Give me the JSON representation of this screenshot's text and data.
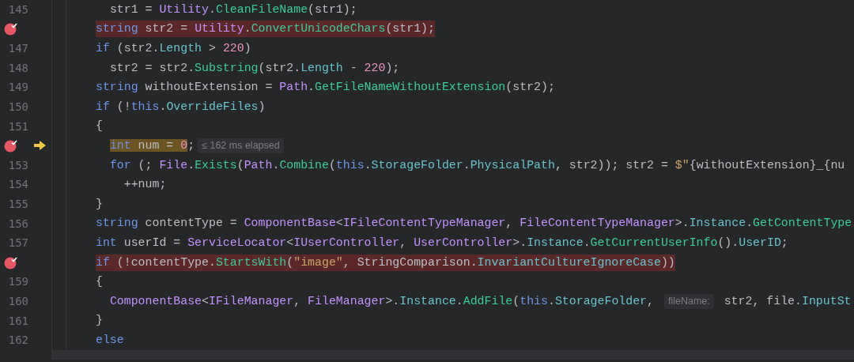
{
  "editor": {
    "lines": [
      {
        "number": "145",
        "breakpoint": false,
        "current": false,
        "highlighted": false,
        "nested": true,
        "tokens": [
          {
            "kind": "plain",
            "text": "str1 = "
          },
          {
            "kind": "type",
            "text": "Utility"
          },
          {
            "kind": "plain",
            "text": "."
          },
          {
            "kind": "method",
            "text": "CleanFileName"
          },
          {
            "kind": "plain",
            "text": "(str1);"
          }
        ]
      },
      {
        "breakpoint": true,
        "current": false,
        "highlighted": true,
        "nested": false,
        "tokens": [
          {
            "kind": "keyword",
            "text": "string"
          },
          {
            "kind": "plain",
            "text": " str2 = "
          },
          {
            "kind": "type",
            "text": "Utility"
          },
          {
            "kind": "plain",
            "text": "."
          },
          {
            "kind": "method",
            "text": "ConvertUnicodeChars"
          },
          {
            "kind": "plain",
            "text": "(str1);"
          }
        ]
      },
      {
        "number": "147",
        "breakpoint": false,
        "current": false,
        "highlighted": false,
        "nested": false,
        "tokens": [
          {
            "kind": "keyword",
            "text": "if"
          },
          {
            "kind": "plain",
            "text": " (str2."
          },
          {
            "kind": "property",
            "text": "Length"
          },
          {
            "kind": "plain",
            "text": " > "
          },
          {
            "kind": "number",
            "text": "220"
          },
          {
            "kind": "plain",
            "text": ")"
          }
        ]
      },
      {
        "number": "148",
        "breakpoint": false,
        "current": false,
        "highlighted": false,
        "nested": true,
        "tokens": [
          {
            "kind": "plain",
            "text": "str2 = str2."
          },
          {
            "kind": "method",
            "text": "Substring"
          },
          {
            "kind": "plain",
            "text": "(str2."
          },
          {
            "kind": "property",
            "text": "Length"
          },
          {
            "kind": "plain",
            "text": " - "
          },
          {
            "kind": "number",
            "text": "220"
          },
          {
            "kind": "plain",
            "text": ");"
          }
        ]
      },
      {
        "number": "149",
        "breakpoint": false,
        "current": false,
        "highlighted": false,
        "nested": false,
        "tokens": [
          {
            "kind": "keyword",
            "text": "string"
          },
          {
            "kind": "plain",
            "text": " withoutExtension = "
          },
          {
            "kind": "type",
            "text": "Path"
          },
          {
            "kind": "plain",
            "text": "."
          },
          {
            "kind": "method",
            "text": "GetFileNameWithoutExtension"
          },
          {
            "kind": "plain",
            "text": "(str2);"
          }
        ]
      },
      {
        "number": "150",
        "breakpoint": false,
        "current": false,
        "highlighted": false,
        "nested": false,
        "tokens": [
          {
            "kind": "keyword",
            "text": "if"
          },
          {
            "kind": "plain",
            "text": " (!"
          },
          {
            "kind": "keyword",
            "text": "this"
          },
          {
            "kind": "plain",
            "text": "."
          },
          {
            "kind": "property",
            "text": "OverrideFiles"
          },
          {
            "kind": "plain",
            "text": ")"
          }
        ]
      },
      {
        "number": "151",
        "breakpoint": false,
        "current": false,
        "highlighted": false,
        "nested": false,
        "tokens": [
          {
            "kind": "plain",
            "text": "{"
          }
        ]
      },
      {
        "breakpoint": true,
        "current": true,
        "highlighted": false,
        "nested": true,
        "tokens": [
          {
            "kind": "keyword",
            "text": "int",
            "executing": true
          },
          {
            "kind": "plain",
            "text": " num = ",
            "executing": true
          },
          {
            "kind": "number",
            "text": "0",
            "executing": true
          },
          {
            "kind": "plain",
            "text": ";",
            "executing": false
          },
          {
            "kind": "hint",
            "text": "≤ 162 ms elapsed"
          }
        ]
      },
      {
        "number": "153",
        "breakpoint": false,
        "current": false,
        "highlighted": false,
        "nested": true,
        "tokens": [
          {
            "kind": "keyword",
            "text": "for"
          },
          {
            "kind": "plain",
            "text": " (; "
          },
          {
            "kind": "type",
            "text": "File"
          },
          {
            "kind": "plain",
            "text": "."
          },
          {
            "kind": "method",
            "text": "Exists"
          },
          {
            "kind": "plain",
            "text": "("
          },
          {
            "kind": "type",
            "text": "Path"
          },
          {
            "kind": "plain",
            "text": "."
          },
          {
            "kind": "method",
            "text": "Combine"
          },
          {
            "kind": "plain",
            "text": "("
          },
          {
            "kind": "keyword",
            "text": "this"
          },
          {
            "kind": "plain",
            "text": "."
          },
          {
            "kind": "property",
            "text": "StorageFolder"
          },
          {
            "kind": "plain",
            "text": "."
          },
          {
            "kind": "property",
            "text": "PhysicalPath"
          },
          {
            "kind": "plain",
            "text": ", str2)); str2 = "
          },
          {
            "kind": "string",
            "text": "$\""
          },
          {
            "kind": "plain",
            "text": "{withoutExtension}_{nu"
          }
        ]
      },
      {
        "number": "154",
        "breakpoint": false,
        "current": false,
        "highlighted": false,
        "nested": true,
        "tokens": [
          {
            "kind": "plain",
            "text": "  ++num;"
          }
        ]
      },
      {
        "number": "155",
        "breakpoint": false,
        "current": false,
        "highlighted": false,
        "nested": false,
        "tokens": [
          {
            "kind": "plain",
            "text": "}"
          }
        ]
      },
      {
        "number": "156",
        "breakpoint": false,
        "current": false,
        "highlighted": false,
        "nested": false,
        "tokens": [
          {
            "kind": "keyword",
            "text": "string"
          },
          {
            "kind": "plain",
            "text": " contentType = "
          },
          {
            "kind": "type",
            "text": "ComponentBase"
          },
          {
            "kind": "plain",
            "text": "<"
          },
          {
            "kind": "type",
            "text": "IFileContentTypeManager"
          },
          {
            "kind": "plain",
            "text": ", "
          },
          {
            "kind": "type",
            "text": "FileContentTypeManager"
          },
          {
            "kind": "plain",
            "text": ">."
          },
          {
            "kind": "property",
            "text": "Instance"
          },
          {
            "kind": "plain",
            "text": "."
          },
          {
            "kind": "method",
            "text": "GetContentType"
          }
        ]
      },
      {
        "number": "157",
        "breakpoint": false,
        "current": false,
        "highlighted": false,
        "nested": false,
        "tokens": [
          {
            "kind": "keyword",
            "text": "int"
          },
          {
            "kind": "plain",
            "text": " userId = "
          },
          {
            "kind": "type",
            "text": "ServiceLocator"
          },
          {
            "kind": "plain",
            "text": "<"
          },
          {
            "kind": "type",
            "text": "IUserController"
          },
          {
            "kind": "plain",
            "text": ", "
          },
          {
            "kind": "type",
            "text": "UserController"
          },
          {
            "kind": "plain",
            "text": ">."
          },
          {
            "kind": "property",
            "text": "Instance"
          },
          {
            "kind": "plain",
            "text": "."
          },
          {
            "kind": "method",
            "text": "GetCurrentUserInfo"
          },
          {
            "kind": "plain",
            "text": "()."
          },
          {
            "kind": "property",
            "text": "UserID"
          },
          {
            "kind": "plain",
            "text": ";"
          }
        ]
      },
      {
        "breakpoint": true,
        "current": false,
        "highlighted": true,
        "nested": false,
        "tokens": [
          {
            "kind": "keyword",
            "text": "if"
          },
          {
            "kind": "plain",
            "text": " (!contentType."
          },
          {
            "kind": "method",
            "text": "StartsWith"
          },
          {
            "kind": "plain",
            "text": "("
          },
          {
            "kind": "string",
            "text": "\"image\""
          },
          {
            "kind": "plain",
            "text": ", StringComparison."
          },
          {
            "kind": "property",
            "text": "InvariantCultureIgnoreCase"
          },
          {
            "kind": "plain",
            "text": "))"
          }
        ]
      },
      {
        "number": "159",
        "breakpoint": false,
        "current": false,
        "highlighted": false,
        "nested": false,
        "tokens": [
          {
            "kind": "plain",
            "text": "{"
          }
        ]
      },
      {
        "number": "160",
        "breakpoint": false,
        "current": false,
        "highlighted": false,
        "nested": true,
        "tokens": [
          {
            "kind": "type",
            "text": "ComponentBase"
          },
          {
            "kind": "plain",
            "text": "<"
          },
          {
            "kind": "type",
            "text": "IFileManager"
          },
          {
            "kind": "plain",
            "text": ", "
          },
          {
            "kind": "type",
            "text": "FileManager"
          },
          {
            "kind": "plain",
            "text": ">."
          },
          {
            "kind": "property",
            "text": "Instance"
          },
          {
            "kind": "plain",
            "text": "."
          },
          {
            "kind": "method",
            "text": "AddFile"
          },
          {
            "kind": "plain",
            "text": "("
          },
          {
            "kind": "keyword",
            "text": "this"
          },
          {
            "kind": "plain",
            "text": "."
          },
          {
            "kind": "property",
            "text": "StorageFolder"
          },
          {
            "kind": "plain",
            "text": ", "
          },
          {
            "kind": "hint",
            "text": "fileName:"
          },
          {
            "kind": "plain",
            "text": " str2, file."
          },
          {
            "kind": "property",
            "text": "InputSt"
          }
        ]
      },
      {
        "number": "161",
        "breakpoint": false,
        "current": false,
        "highlighted": false,
        "nested": false,
        "tokens": [
          {
            "kind": "plain",
            "text": "}"
          }
        ]
      },
      {
        "number": "162",
        "breakpoint": false,
        "current": false,
        "highlighted": false,
        "nested": false,
        "tokens": [
          {
            "kind": "keyword",
            "text": "else"
          }
        ]
      }
    ]
  }
}
